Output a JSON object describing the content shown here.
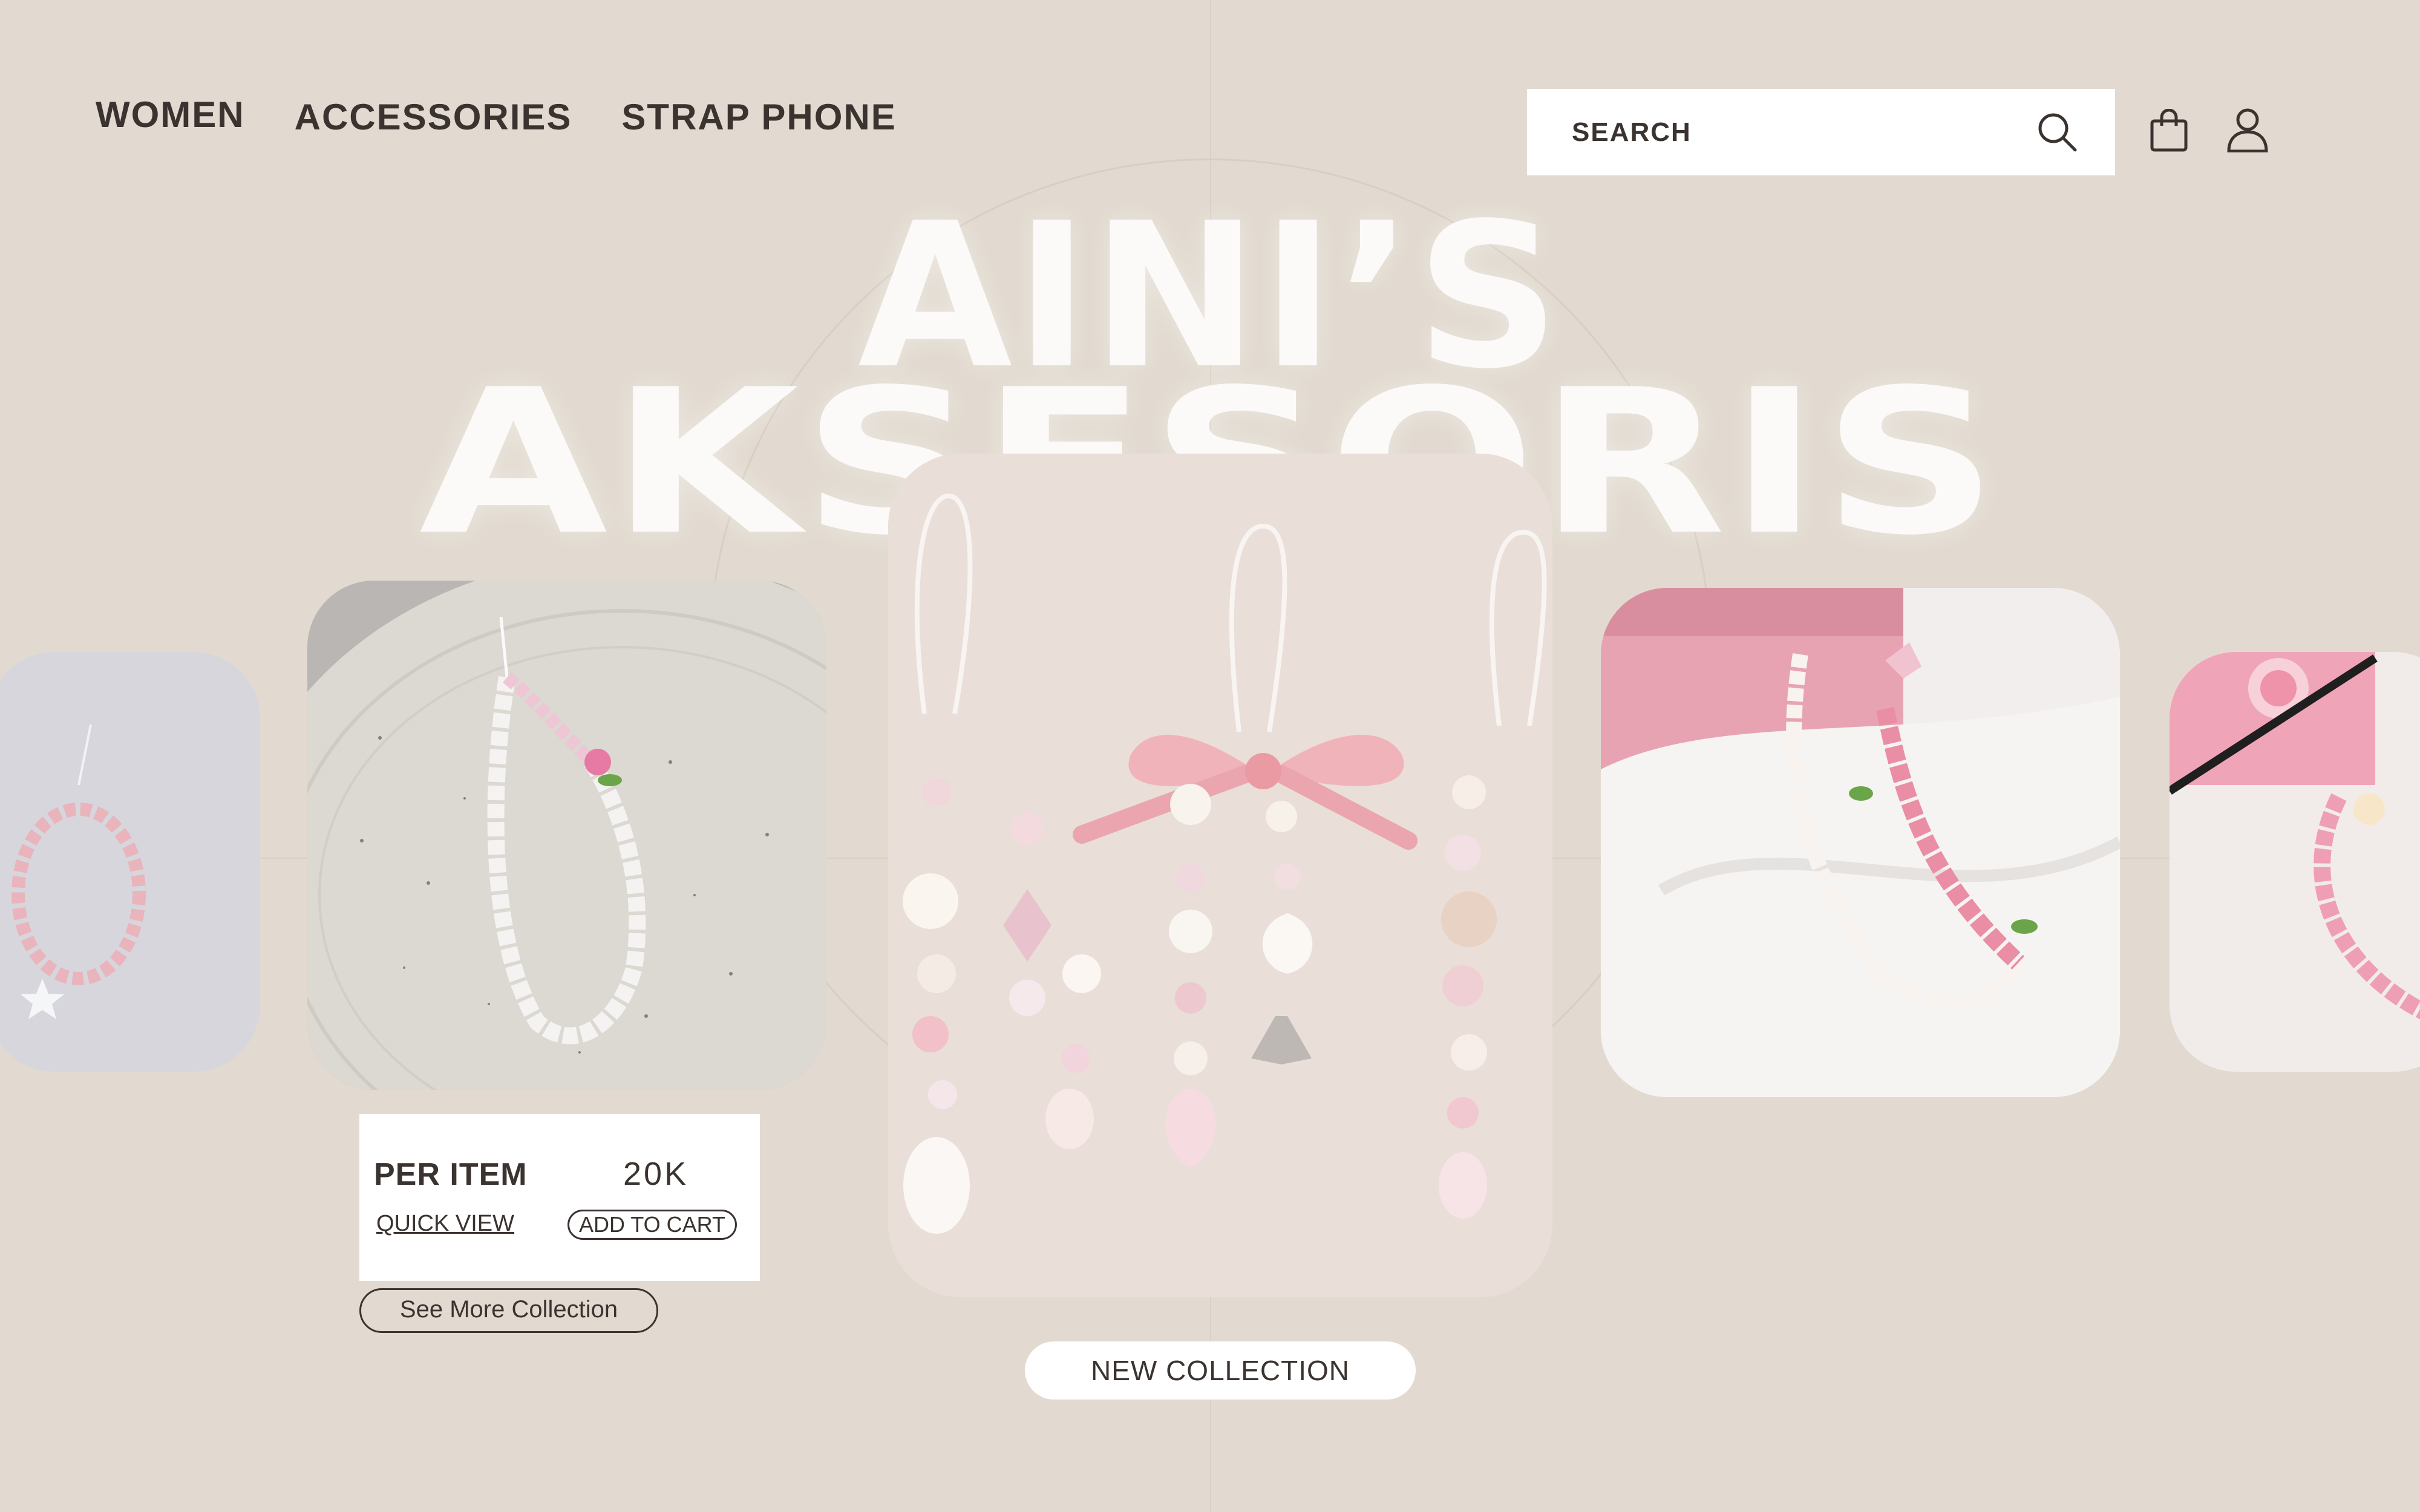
{
  "nav": {
    "items": [
      "WOMEN",
      "ACCESSORIES",
      "STRAP PHONE"
    ]
  },
  "search": {
    "placeholder": "SEARCH",
    "icon": "search-icon"
  },
  "header_icons": [
    "bag-icon",
    "user-icon"
  ],
  "hero": {
    "line1": "AINI’S",
    "line2": "AKSESORIS"
  },
  "product": {
    "per_item_label": "PER ITEM",
    "price": "20K",
    "quick_view": "QUICK VIEW",
    "add_to_cart": "ADD TO CART"
  },
  "buttons": {
    "see_more": "See More Collection",
    "new_collection": "NEW COLLECTION"
  },
  "colors": {
    "background": "#e2dad0",
    "text": "#3b332f",
    "title": "#fbfaf8",
    "panel": "#ffffff"
  }
}
